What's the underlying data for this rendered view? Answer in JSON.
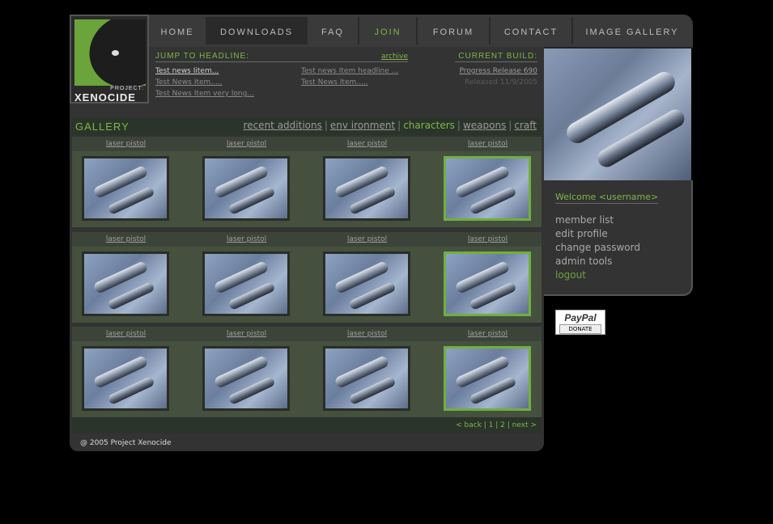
{
  "logo": {
    "line1": "PROJECT:",
    "line2": "XENOCIDE"
  },
  "nav": [
    "HOME",
    "DOWNLOADS",
    "FAQ",
    "JOIN",
    "FORUM",
    "CONTACT",
    "IMAGE GALLERY"
  ],
  "headlines": {
    "label": "JUMP TO HEADLINE:",
    "archive": "archive",
    "items": [
      "Test news Iitem...",
      "Test News Item.....",
      "Test News Item very long...",
      "Test news Item headline ...",
      "Test News Item....."
    ]
  },
  "build": {
    "label": "CURRENT BUILD:",
    "name": "Progress Release 690",
    "date": "Released 11/9/2005"
  },
  "gallery": {
    "title": "GALLERY",
    "filters": [
      "recent additions",
      "env ironment",
      "characters",
      "weapons",
      "craft"
    ],
    "active_filter": "characters",
    "caption": "laser pistol",
    "rows": 3,
    "cols": 4
  },
  "pager": {
    "text": "< back | 1 | 2 | next >"
  },
  "copyright": "@ 2005 Project Xenocide",
  "sidebar": {
    "welcome": "Welcome <username>",
    "menu": [
      "member list",
      "edit profile",
      "change password",
      "admin tools",
      "logout"
    ]
  },
  "paypal": {
    "brand": "PayPal",
    "action": "DONATE"
  },
  "colors": {
    "accent": "#7fb648",
    "panel": "#333333",
    "background": "#000000"
  }
}
